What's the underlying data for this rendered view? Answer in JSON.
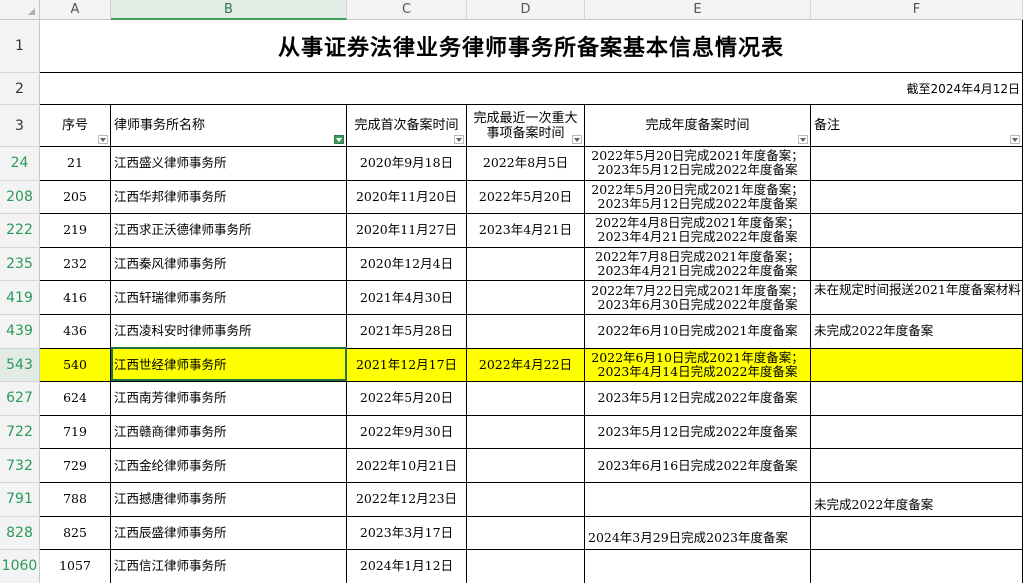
{
  "columns": [
    "A",
    "B",
    "C",
    "D",
    "E",
    "F"
  ],
  "title": "从事证券法律业务律师事务所备案基本信息情况表",
  "date_note": "截至2024年4月12日",
  "headers": {
    "seq": "序号",
    "name": "律师事务所名称",
    "first": "完成首次备案时间",
    "major": "完成最近一次重大\n事项备案时间",
    "annual": "完成年度备案时间",
    "remark": "备注"
  },
  "header_row_numbers": [
    "1",
    "2",
    "3"
  ],
  "rows": [
    {
      "rownum": "24",
      "seq": "21",
      "name": "江西盛义律师事务所",
      "first": "2020年9月18日",
      "major": "2022年8月5日",
      "annual": "2022年5月20日完成2021年度备案；\n2023年5月12日完成2022年度备案",
      "remark": ""
    },
    {
      "rownum": "208",
      "seq": "205",
      "name": "江西华邦律师事务所",
      "first": "2020年11月20日",
      "major": "2022年5月20日",
      "annual": "2022年5月20日完成2021年度备案；\n2023年5月12日完成2022年度备案",
      "remark": ""
    },
    {
      "rownum": "222",
      "seq": "219",
      "name": "江西求正沃德律师事务所",
      "first": "2020年11月27日",
      "major": "2023年4月21日",
      "annual": "2022年4月8日完成2021年度备案；\n2023年4月21日完成2022年度备案",
      "remark": ""
    },
    {
      "rownum": "235",
      "seq": "232",
      "name": "江西秦风律师事务所",
      "first": "2020年12月4日",
      "major": "",
      "annual": "2022年7月8日完成2021年度备案；\n2023年4月21日完成2022年度备案",
      "remark": ""
    },
    {
      "rownum": "419",
      "seq": "416",
      "name": "江西轩瑞律师事务所",
      "first": "2021年4月30日",
      "major": "",
      "annual": "2022年7月22日完成2021年度备案；\n2023年6月30日完成2022年度备案",
      "remark": "未在规定时间报送2021年度备案材料"
    },
    {
      "rownum": "439",
      "seq": "436",
      "name": "江西凌科安时律师事务所",
      "first": "2021年5月28日",
      "major": "",
      "annual": "2022年6月10日完成2021年度备案",
      "remark": "未完成2022年度备案"
    },
    {
      "rownum": "543",
      "seq": "540",
      "name": "江西世经律师事务所",
      "first": "2021年12月17日",
      "major": "2022年4月22日",
      "annual": "2022年6月10日完成2021年度备案；\n2023年4月14日完成2022年度备案",
      "remark": ""
    },
    {
      "rownum": "627",
      "seq": "624",
      "name": "江西南芳律师事务所",
      "first": "2022年5月20日",
      "major": "",
      "annual": "2023年5月12日完成2022年度备案",
      "remark": ""
    },
    {
      "rownum": "722",
      "seq": "719",
      "name": "江西赣商律师事务所",
      "first": "2022年9月30日",
      "major": "",
      "annual": "2023年5月12日完成2022年度备案",
      "remark": ""
    },
    {
      "rownum": "732",
      "seq": "729",
      "name": "江西金纶律师事务所",
      "first": "2022年10月21日",
      "major": "",
      "annual": "2023年6月16日完成2022年度备案",
      "remark": ""
    },
    {
      "rownum": "791",
      "seq": "788",
      "name": "江西撼唐律师事务所",
      "first": "2022年12月23日",
      "major": "",
      "annual": "",
      "remark": "未完成2022年度备案"
    },
    {
      "rownum": "828",
      "seq": "825",
      "name": "江西辰盛律师事务所",
      "first": "2023年3月17日",
      "major": "",
      "annual": "2024年3月29日完成2023年度备案",
      "remark": ""
    },
    {
      "rownum": "1060",
      "seq": "1057",
      "name": "江西信江律师事务所",
      "first": "2024年1月12日",
      "major": "",
      "annual": "",
      "remark": ""
    }
  ],
  "colors": {
    "highlight": "#ffff00",
    "filter_green": "#3c9b5f",
    "row_number_filtered": "#2a9a5a"
  }
}
